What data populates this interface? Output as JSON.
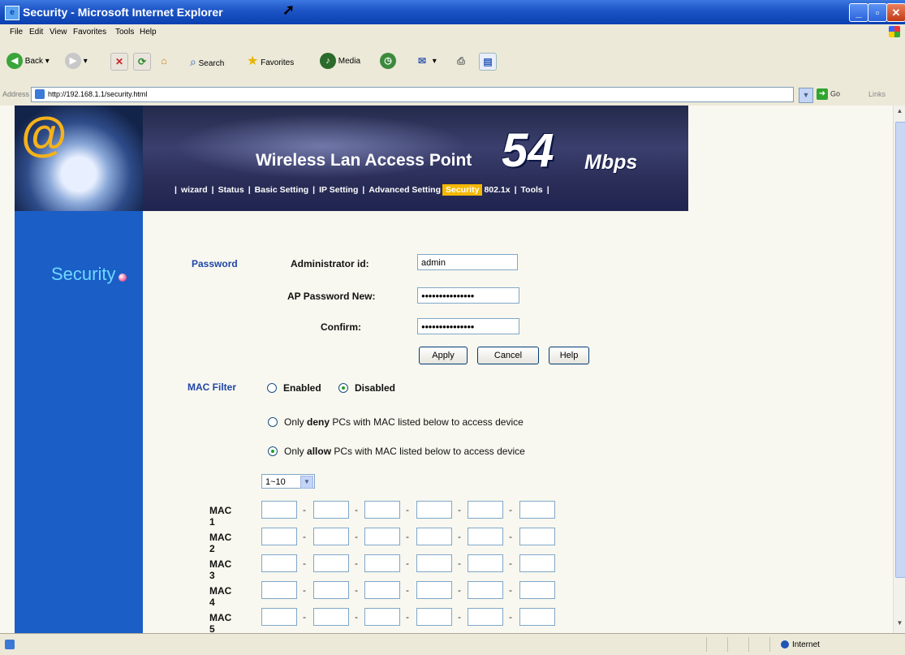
{
  "window": {
    "title": "Security - Microsoft Internet Explorer"
  },
  "menu": [
    "File",
    "Edit",
    "View",
    "Favorites",
    "Tools",
    "Help"
  ],
  "toolbar": {
    "back_label": "Back",
    "search_label": "Search",
    "favorites_label": "Favorites",
    "media_label": "Media"
  },
  "address_bar": {
    "label": "Address",
    "url": "http://192.168.1.1/security.html",
    "go_label": "Go",
    "links_label": "Links"
  },
  "banner": {
    "title": "Wireless Lan Access Point",
    "speed": "54",
    "speed_unit": "Mbps",
    "nav": [
      "wizard",
      "Status",
      "Basic Setting",
      "IP Setting",
      "Advanced Setting",
      "Security",
      "802.1x",
      "Tools"
    ],
    "active_nav": "Security"
  },
  "page_label": "Security",
  "password_section": {
    "label": "Password",
    "admin_id_label": "Administrator id:",
    "admin_id_value": "admin",
    "new_password_label": "AP Password New:",
    "new_password_value": "●●●●●●●●●●●●●●●",
    "confirm_label": "Confirm:",
    "confirm_value": "●●●●●●●●●●●●●●●"
  },
  "buttons": {
    "apply": "Apply",
    "cancel": "Cancel",
    "help": "Help"
  },
  "mac_filter": {
    "label": "MAC Filter",
    "enabled_label": "Enabled",
    "disabled_label": "Disabled",
    "selected": "Disabled",
    "deny_prefix": "Only",
    "deny_bold": "deny",
    "deny_suffix": "PCs with MAC listed below to access device",
    "allow_prefix": "Only",
    "allow_bold": "allow",
    "allow_suffix": "PCs with MAC listed below to access device",
    "mode_selected": "allow",
    "range_select": "1~10",
    "mac_labels": [
      "MAC 1",
      "MAC 2",
      "MAC 3",
      "MAC 4",
      "MAC 5"
    ]
  },
  "status_bar": {
    "zone": "Internet"
  }
}
